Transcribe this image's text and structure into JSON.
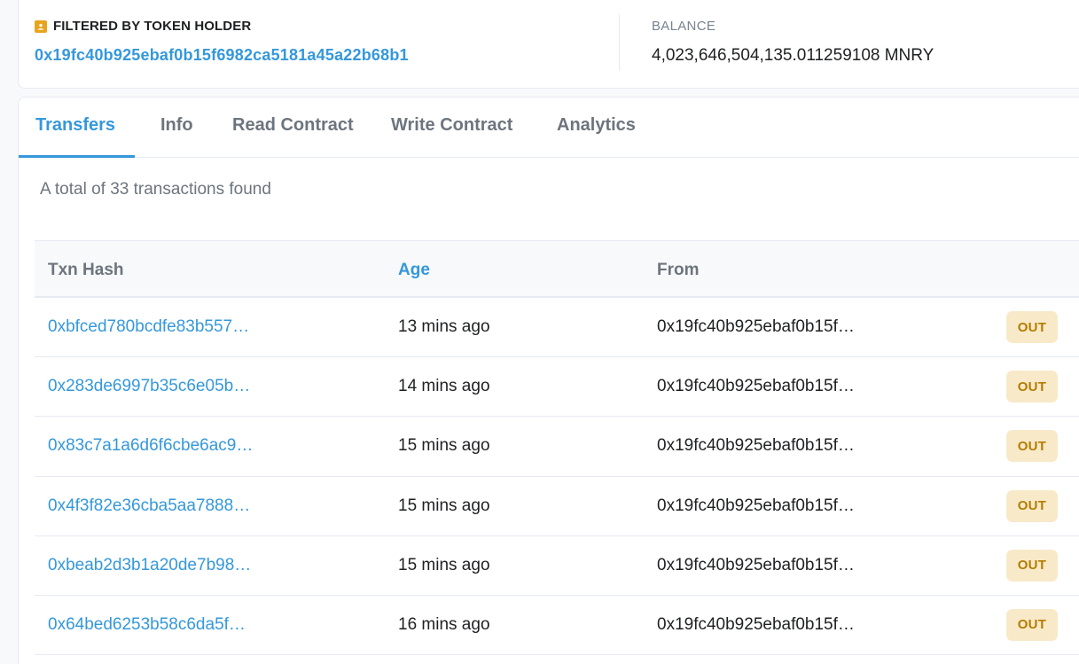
{
  "filter": {
    "title": "FILTERED BY TOKEN HOLDER",
    "address": "0x19fc40b925ebaf0b15f6982ca5181a45a22b68b1",
    "balance_label": "BALANCE",
    "balance_value": "4,023,646,504,135.011259108 MNRY",
    "icon": "user-badge-icon",
    "icon_color": "#e9a41d"
  },
  "tabs": [
    {
      "label": "Transfers",
      "active": true
    },
    {
      "label": "Info"
    },
    {
      "label": "Read Contract"
    },
    {
      "label": "Write Contract"
    },
    {
      "label": "Analytics"
    }
  ],
  "summary": "A total of 33 transactions found",
  "table": {
    "headers": {
      "hash": "Txn Hash",
      "age": "Age",
      "from": "From"
    },
    "rows": [
      {
        "hash": "0xbfced780bcdfe83b557…",
        "age": "13 mins ago",
        "from": "0x19fc40b925ebaf0b15f…",
        "direction": "OUT"
      },
      {
        "hash": "0x283de6997b35c6e05b…",
        "age": "14 mins ago",
        "from": "0x19fc40b925ebaf0b15f…",
        "direction": "OUT"
      },
      {
        "hash": "0x83c7a1a6d6f6cbe6ac9…",
        "age": "15 mins ago",
        "from": "0x19fc40b925ebaf0b15f…",
        "direction": "OUT"
      },
      {
        "hash": "0x4f3f82e36cba5aa7888…",
        "age": "15 mins ago",
        "from": "0x19fc40b925ebaf0b15f…",
        "direction": "OUT"
      },
      {
        "hash": "0xbeab2d3b1a20de7b98…",
        "age": "15 mins ago",
        "from": "0x19fc40b925ebaf0b15f…",
        "direction": "OUT"
      },
      {
        "hash": "0x64bed6253b58c6da5f…",
        "age": "16 mins ago",
        "from": "0x19fc40b925ebaf0b15f…",
        "direction": "OUT"
      }
    ]
  },
  "colors": {
    "accent": "#3498db",
    "out_badge_bg": "#f8e9c9",
    "out_badge_text": "#b47d00"
  }
}
